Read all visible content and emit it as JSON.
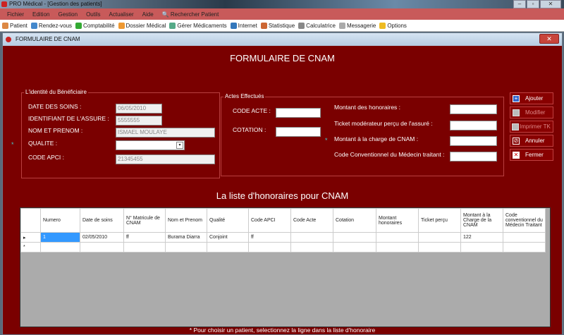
{
  "window": {
    "title": "PRO Médical - [Gestion des patients]"
  },
  "menu": [
    "Fichier",
    "Edition",
    "Gestion",
    "Outils",
    "Actualiser",
    "Aide",
    "Rechercher Patient"
  ],
  "toolbar": [
    {
      "label": "Patient",
      "color": "#d84"
    },
    {
      "label": "Rendez-vous",
      "color": "#48c"
    },
    {
      "label": "Comptabilité",
      "color": "#3a3"
    },
    {
      "label": "Dossier Médical",
      "color": "#e93"
    },
    {
      "label": "Gérer Médicaments",
      "color": "#5a8"
    },
    {
      "label": "Internet",
      "color": "#37b"
    },
    {
      "label": "Statistique",
      "color": "#c63"
    },
    {
      "label": "Calculatrice",
      "color": "#888"
    },
    {
      "label": "Messagerie",
      "color": "#aaa"
    },
    {
      "label": "Options",
      "color": "#eb2"
    }
  ],
  "child": {
    "title": "FORMULAIRE DE CNAM",
    "close": "✕"
  },
  "form": {
    "heading": "FORMULAIRE  DE CNAM",
    "identity": {
      "legend": "L'identité du Bénéficiaire",
      "date_label": "DATE DES SOINS :",
      "date_value": "06/05/2010",
      "id_label": "IDENTIFIANT DE L'ASSURE :",
      "id_value": "5555555",
      "name_label": "NOM ET PRENOM :",
      "name_value": "ISMAEL MOULAYE",
      "qualite_label": "QUALITE :",
      "qualite_value": "",
      "apci_label": "CODE APCI :",
      "apci_value": "21345455"
    },
    "actes": {
      "legend": "Actes Effectués",
      "code_label": "CODE ACTE :",
      "cotation_label": "COTATION :",
      "montant_label": "Montant des honoraires :",
      "ticket_label": "Ticket modérateur perçu de l'assuré :",
      "charge_label": "Montant à la charge de CNAM :",
      "conv_label": "Code Conventionnel du Médecin traitant :"
    },
    "required_mark": "*",
    "buttons": {
      "add": "Ajouter",
      "edit": "Modifier",
      "print": "Imprimer TK",
      "cancel": "Annuler",
      "close": "Fermer"
    }
  },
  "list": {
    "heading": "La liste d'honoraires pour CNAM",
    "columns": [
      "Numero",
      "Date de soins",
      "N° Matricule de CNAM",
      "Nom et Prenom",
      "Qualité",
      "Code APCI",
      "Code Acte",
      "Cotation",
      "Montant honoraires",
      "Ticket perçu",
      "Montant à la Charge de la CNAM",
      "Code conventionnel du Médecin Traitant"
    ],
    "rows": [
      [
        "1",
        "02/05/2010",
        "ff",
        "Burama Diarra",
        "Conjoint",
        "ff",
        "",
        "",
        "",
        "",
        "122",
        ""
      ]
    ],
    "new_row_marker": "*",
    "current_row_marker": "▸"
  },
  "footer": "* Pour choisir un patient, selectionnez la ligne dans la liste d'honoraire"
}
